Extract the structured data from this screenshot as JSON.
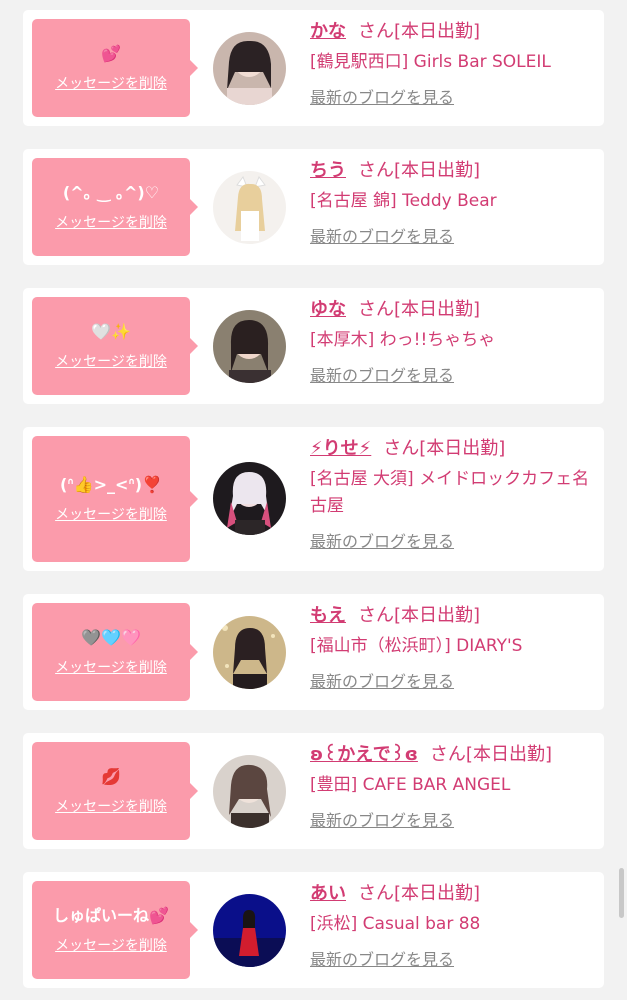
{
  "common": {
    "delete_label": "メッセージを削除",
    "blog_label": "最新のブログを見る",
    "san": "さん",
    "status": "[本日出勤]"
  },
  "colors": {
    "bubble": "#fb9bab",
    "accent": "#d23c73",
    "link_gray": "#888888",
    "card": "#ffffff",
    "background": "#f2f2f2"
  },
  "items": [
    {
      "message": "💕",
      "name": "かな",
      "shop": "[鶴見駅西口] Girls Bar SOLEIL",
      "avatar": "avatar-photo"
    },
    {
      "message": "(^｡ ‿ ｡^)♡",
      "name": "ちう",
      "shop": "[名古屋 錦] Teddy Bear",
      "avatar": "avatar-photo"
    },
    {
      "message": "🤍✨",
      "name": "ゆな",
      "shop": "[本厚木] わっ!!ちゃちゃ",
      "avatar": "avatar-photo"
    },
    {
      "message": "(ᐢ👍>_<ᐢ)❣️",
      "name": "⚡りせ⚡",
      "shop": "[名古屋 大須] メイドロックカフェ名古屋",
      "avatar": "avatar-photo"
    },
    {
      "message": "🩶🩵🩷",
      "name": "もえ",
      "shop": "[福山市（松浜町）] DIARY'S",
      "avatar": "avatar-photo"
    },
    {
      "message": "💋",
      "name": "ʚ꒰かえで꒱ɞ",
      "shop": "[豊田] CAFE BAR ANGEL",
      "avatar": "avatar-photo"
    },
    {
      "message": "しゅぱいーね💕",
      "name": "あい",
      "shop": "[浜松] Casual bar 88",
      "avatar": "avatar-photo"
    }
  ]
}
